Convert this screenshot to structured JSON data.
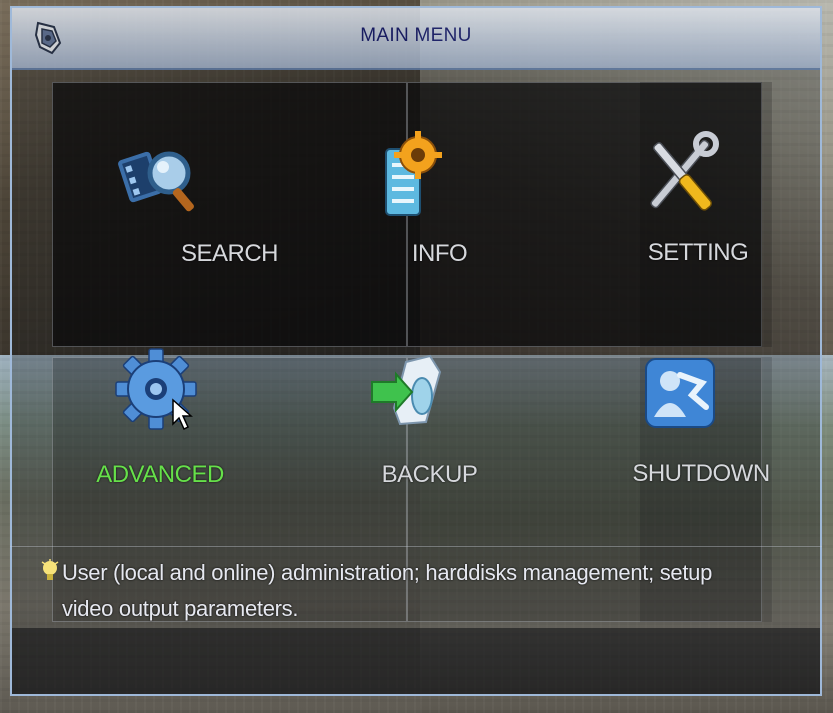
{
  "window": {
    "title": "MAIN MENU"
  },
  "menu": {
    "items": [
      {
        "label": "SEARCH",
        "icon": "search-icon",
        "selected": false
      },
      {
        "label": "INFO",
        "icon": "info-icon",
        "selected": false
      },
      {
        "label": "SETTING",
        "icon": "setting-icon",
        "selected": false
      },
      {
        "label": "ADVANCED",
        "icon": "advanced-icon",
        "selected": true
      },
      {
        "label": "BACKUP",
        "icon": "backup-icon",
        "selected": false
      },
      {
        "label": "SHUTDOWN",
        "icon": "shutdown-icon",
        "selected": false
      }
    ]
  },
  "help": {
    "text": "User (local and online) administration; harddisks management; setup video output parameters."
  },
  "colors": {
    "selected_label": "#66e04a",
    "label": "#d6d8dc",
    "title_text": "#10166b",
    "border": "#9fb9d9"
  }
}
